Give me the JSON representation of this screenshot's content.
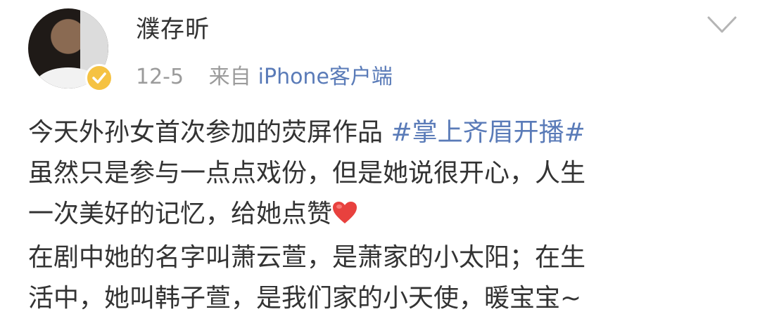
{
  "author": {
    "name": "濮存昕",
    "avatar_icon": "avatar-photo",
    "verified_icon": "verified-badge-icon",
    "verified_color": "#f5c242"
  },
  "meta": {
    "date": "12-5",
    "source_prefix": "来自",
    "device": "iPhone客户端"
  },
  "menu_icon": "chevron-down-icon",
  "post": {
    "line1_text": "今天外孙女首次参加的荧屏作品 ",
    "line1_tag": "#掌上齐眉开播#",
    "line2": "虽然只是参与一点点戏份，但是她说很开心，人生",
    "line3_text": "一次美好的记忆，给她点赞",
    "line3_emoji": "heart-emoji",
    "line4": "在剧中她的名字叫萧云萱，是萧家的小太阳；在生",
    "line5": "活中，她叫韩子萱，是我们家的小天使，暖宝宝~"
  },
  "colors": {
    "text": "#333333",
    "meta": "#9b9b9b",
    "link": "#5a7bb8",
    "heart": "#e8413e"
  }
}
